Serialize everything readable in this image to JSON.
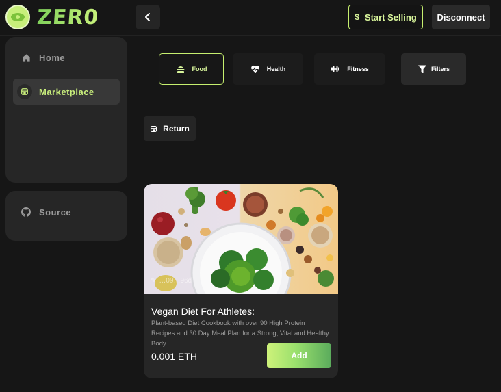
{
  "brand": {
    "name": "ZER0",
    "accent": "#c6ef6f"
  },
  "header": {
    "start_selling_label": "Start Selling",
    "start_selling_icon": "$",
    "disconnect_label": "Disconnect"
  },
  "sidebar": {
    "items": [
      {
        "label": "Home",
        "icon": "home-icon"
      },
      {
        "label": "Marketplace",
        "icon": "store-icon"
      }
    ],
    "secondary": [
      {
        "label": "Source",
        "icon": "github-icon"
      }
    ]
  },
  "categories": [
    {
      "label": "Food",
      "icon": "burger-icon",
      "active": true
    },
    {
      "label": "Health",
      "icon": "heart-pulse-icon"
    },
    {
      "label": "Fitness",
      "icon": "dumbbell-icon"
    },
    {
      "label": "Filters",
      "icon": "filter-icon"
    }
  ],
  "return_label": "Return",
  "product": {
    "title": "Vegan Diet For Athletes:",
    "description": "Plant-based Diet Cookbook with over 90 High Protein Recipes and 30 Day Meal Plan for a Strong, Vital and Healthy Body",
    "price": "0.001 ETH",
    "image_caption": "…09…96d",
    "add_label": "Add"
  }
}
